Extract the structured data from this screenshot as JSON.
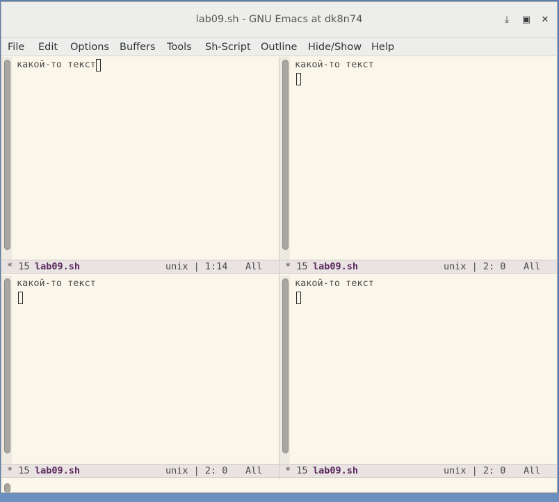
{
  "window": {
    "title": "lab09.sh - GNU Emacs at dk8n74",
    "controls": [
      "minimize-icon",
      "maximize-icon",
      "close-icon"
    ],
    "minimize_glyph": "⤓",
    "maximize_glyph": "▣",
    "close_glyph": "✕"
  },
  "menu": [
    "File",
    "Edit",
    "Options",
    "Buffers",
    "Tools",
    "Sh-Script",
    "Outline",
    "Hide/Show",
    "Help"
  ],
  "panes": [
    {
      "text": "какой-то текст",
      "modeline": {
        "flag": "* 15",
        "name": "lab09.sh",
        "eol": "unix | 1:14",
        "pos": "All"
      }
    },
    {
      "text": "какой-то текст",
      "modeline": {
        "flag": "* 15",
        "name": "lab09.sh",
        "eol": "unix | 2: 0",
        "pos": "All"
      }
    },
    {
      "text": "какой-то текст",
      "modeline": {
        "flag": "* 15",
        "name": "lab09.sh",
        "eol": "unix | 2: 0",
        "pos": "All"
      }
    },
    {
      "text": "какой-то текст",
      "modeline": {
        "flag": "* 15",
        "name": "lab09.sh",
        "eol": "unix | 2: 0",
        "pos": "All"
      }
    }
  ],
  "colors": {
    "buffer_bg": "#faf6ea",
    "modeline_bg": "#e9e3e3",
    "buffer_name": "#5b2a5e",
    "titlebar_bg": "#ededeb"
  }
}
